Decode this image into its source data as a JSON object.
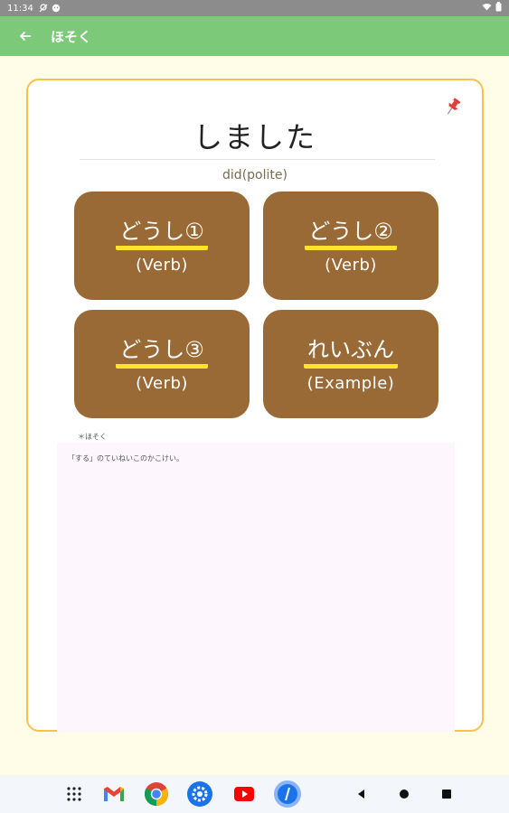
{
  "status_bar": {
    "time": "11:34",
    "icons": [
      "location-off-icon",
      "face-icon",
      "wifi-icon",
      "battery-icon"
    ]
  },
  "app_bar": {
    "title": "ほそく",
    "back_icon": "arrow-left-icon",
    "background": "#7dc97a"
  },
  "card": {
    "word": "しました",
    "meaning": "did(polite)",
    "pin_icon": "pushpin-icon",
    "tiles": [
      {
        "jp": "どうし①",
        "en": "(Verb)"
      },
      {
        "jp": "どうし②",
        "en": "(Verb)"
      },
      {
        "jp": "どうし③",
        "en": "(Verb)"
      },
      {
        "jp": "れいぶん",
        "en": "(Example)"
      }
    ],
    "note_label": "ほそく",
    "note_text": "「する」のていねいこのかこけい。"
  },
  "dock": {
    "apps": [
      "app-drawer-icon",
      "gmail-icon",
      "chrome-icon",
      "settings-icon",
      "youtube-icon",
      "dictionary-app-icon"
    ],
    "nav": [
      "back-nav-icon",
      "home-nav-icon",
      "recents-nav-icon"
    ]
  },
  "colors": {
    "page_bg": "#fffde7",
    "card_border": "#f6c14c",
    "tile_bg": "#9a6a36",
    "tile_underline": "#ffe32b",
    "note_bg": "#fdf6fc"
  }
}
